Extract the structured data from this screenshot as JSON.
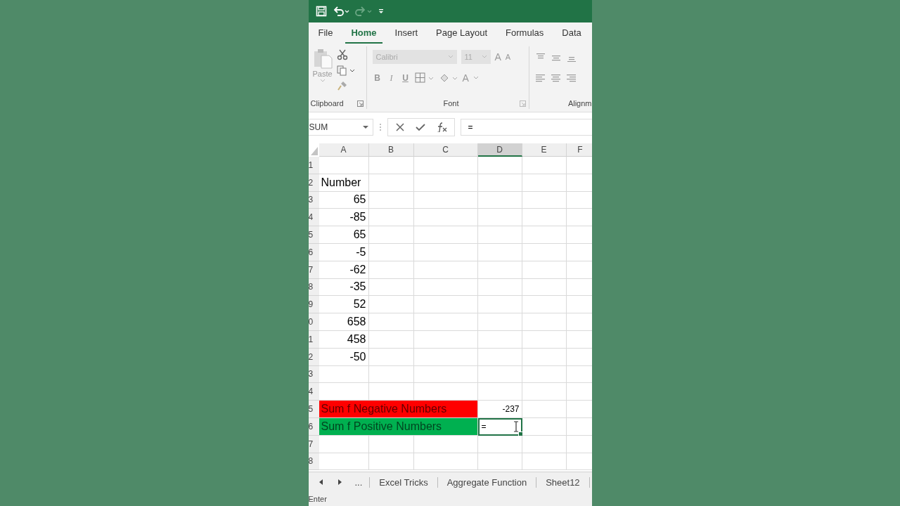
{
  "ribbon_tabs": [
    {
      "label": "File",
      "selected": false
    },
    {
      "label": "Home",
      "selected": true
    },
    {
      "label": "Insert",
      "selected": false
    },
    {
      "label": "Page Layout",
      "selected": false
    },
    {
      "label": "Formulas",
      "selected": false
    },
    {
      "label": "Data",
      "selected": false
    }
  ],
  "ribbon": {
    "paste_label": "Paste",
    "font_name": "Calibri",
    "font_size": "11",
    "grow_letters": [
      "A",
      "A"
    ],
    "format_letters": [
      "B",
      "I",
      "U"
    ],
    "font_color_letter": "A",
    "groups": [
      "Clipboard",
      "Font",
      "Alignm"
    ]
  },
  "formula_bar": {
    "name_box": "SUM",
    "formula": "="
  },
  "columns": [
    {
      "label": "A",
      "selected": false
    },
    {
      "label": "B",
      "selected": false
    },
    {
      "label": "C",
      "selected": false
    },
    {
      "label": "D",
      "selected": true
    },
    {
      "label": "E",
      "selected": false
    },
    {
      "label": "F",
      "selected": false
    }
  ],
  "rows": [
    {
      "header": "1"
    },
    {
      "header": "2",
      "a": {
        "kind": "label",
        "text": "Number"
      }
    },
    {
      "header": "3",
      "a": {
        "kind": "number",
        "text": "65"
      }
    },
    {
      "header": "4",
      "a": {
        "kind": "number",
        "text": "-85"
      }
    },
    {
      "header": "5",
      "a": {
        "kind": "number",
        "text": "65"
      }
    },
    {
      "header": "6",
      "a": {
        "kind": "number",
        "text": "-5"
      }
    },
    {
      "header": "7",
      "a": {
        "kind": "number",
        "text": "-62"
      }
    },
    {
      "header": "8",
      "a": {
        "kind": "number",
        "text": "-35"
      }
    },
    {
      "header": "9",
      "a": {
        "kind": "number",
        "text": "52"
      }
    },
    {
      "header": "0",
      "a": {
        "kind": "number",
        "text": "658"
      }
    },
    {
      "header": "1",
      "a": {
        "kind": "number",
        "text": "458"
      }
    },
    {
      "header": "2",
      "a": {
        "kind": "number",
        "text": "-50"
      }
    },
    {
      "header": "3"
    },
    {
      "header": "4"
    },
    {
      "header": "5",
      "a": {
        "kind": "label",
        "text": "Sum f Negative Numbers",
        "color": "#ff0000",
        "merged": true
      },
      "d": {
        "kind": "small",
        "text": "-237",
        "selected": false
      }
    },
    {
      "header": "6",
      "a": {
        "kind": "label",
        "text": "Sum f Positive Numbers",
        "color": "#00b050",
        "merged": true
      },
      "d": {
        "kind": "editing",
        "text": "=",
        "selected": true
      }
    },
    {
      "header": "7"
    },
    {
      "header": "8"
    }
  ],
  "sheet_tabs": [
    {
      "label": "Excel Tricks",
      "selected": false
    },
    {
      "label": "Aggregate Function",
      "selected": false
    },
    {
      "label": "Sheet12",
      "selected": false
    }
  ],
  "sheet_nav_more": "...",
  "status_bar": {
    "mode": "Enter"
  }
}
